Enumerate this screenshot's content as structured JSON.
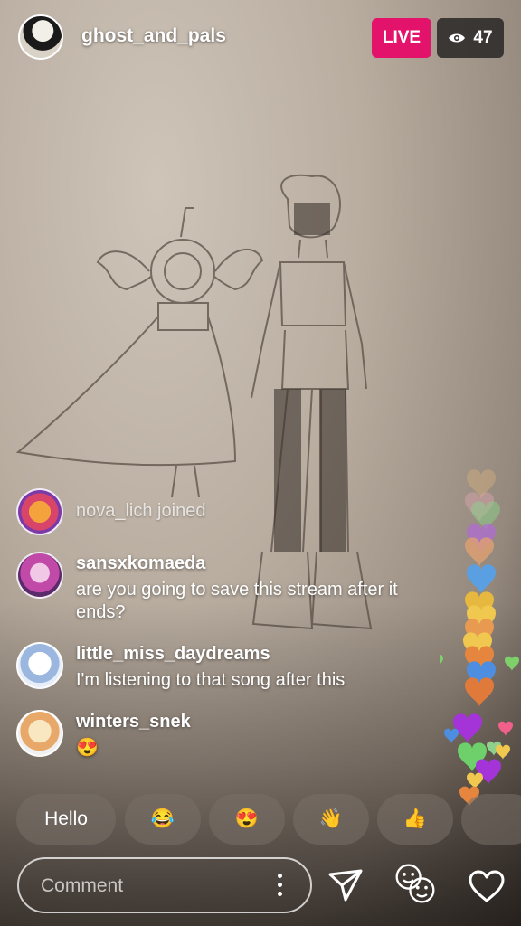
{
  "host": {
    "username": "ghost_and_pals",
    "live_label": "LIVE",
    "viewer_count": "47",
    "avatar_icon": "host-avatar"
  },
  "chat": {
    "joined": {
      "username": "nova_lich",
      "text": "nova_lich joined"
    },
    "messages": [
      {
        "username": "sansxkomaeda",
        "text": "are you going to save this stream after it ends?"
      },
      {
        "username": "little_miss_daydreams",
        "text": "I'm listening to that song after this"
      },
      {
        "username": "winters_snek",
        "text": "😍"
      }
    ]
  },
  "quick_replies": [
    "Hello",
    "😂",
    "😍",
    "👋",
    "👍"
  ],
  "comment": {
    "placeholder": "Comment"
  },
  "colors": {
    "live": "#e3126a",
    "viewer_badge": "#282624"
  },
  "icons": [
    "eye-icon",
    "kebab-icon",
    "send-icon",
    "face-filter-icon",
    "heart-icon"
  ]
}
